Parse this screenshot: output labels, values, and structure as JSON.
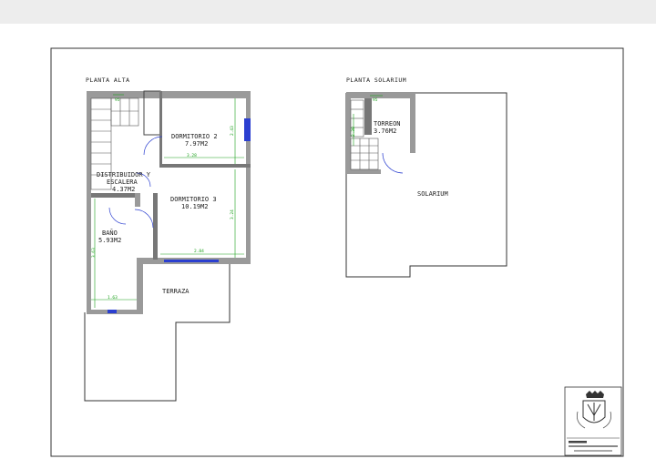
{
  "plans": {
    "upper": {
      "title": "PLANTA ALTA",
      "rooms": {
        "dormitorio2": {
          "name": "DORMITORIO 2",
          "area": "7.97M2"
        },
        "distribuidor": {
          "name_line1": "DISTRIBUIDOR Y",
          "name_line2": "ESCALERA",
          "area": "4.37M2"
        },
        "dormitorio3": {
          "name": "DORMITORIO 3",
          "area": "10.19M2"
        },
        "bano": {
          "name": "BAÑO",
          "area": "5.93M2"
        },
        "terraza": {
          "name": "TERRAZA"
        }
      },
      "dimensions": {
        "d1": "3.28",
        "d2": "2.43",
        "d3": "3.24",
        "d4": "2.84",
        "d5": "3.63",
        "d6": "1.63",
        "d7": "95"
      }
    },
    "solarium": {
      "title": "PLANTA SOLARIUM",
      "rooms": {
        "torreon": {
          "name": "TORREON",
          "area": "3.76M2"
        },
        "solarium": {
          "name": "SOLARIUM"
        }
      },
      "dimensions": {
        "d1": "95",
        "d2": "2.30"
      }
    }
  },
  "colors": {
    "wall": "#444444",
    "dimension": "#1aa01a",
    "window": "#2b3fd0",
    "line": "#333333"
  }
}
